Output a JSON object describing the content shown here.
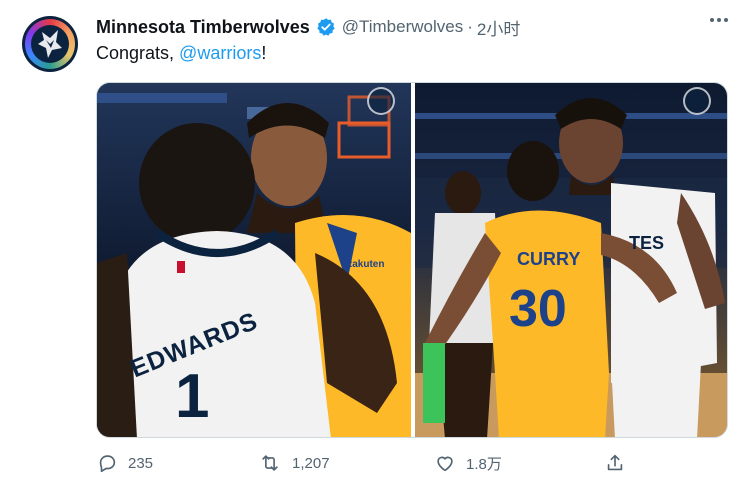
{
  "tweet": {
    "author_name": "Minnesota Timberwolves",
    "handle": "@Timberwolves",
    "separator": "·",
    "time": "2小时",
    "text_prefix": "Congrats, ",
    "mention": "@warriors",
    "text_suffix": "!"
  },
  "photos": {
    "left": {
      "jersey_name": "EDWARDS",
      "jersey_number": "1",
      "sponsor": "Rakuten"
    },
    "right": {
      "jersey_name": "CURRY",
      "jersey_number": "30",
      "jersey_name_2": "TES"
    }
  },
  "actions": {
    "reply_count": "235",
    "retweet_count": "1,207",
    "like_count": "1.8万"
  },
  "colors": {
    "link": "#1d9bf0",
    "verified": "#1d9bf0",
    "muted": "#536471",
    "warriors_gold": "#fdb927",
    "warriors_blue": "#1d428a",
    "wolves_navy": "#0c2340"
  },
  "icons": [
    "wolves-logo-icon",
    "verified-badge-icon",
    "more-options-icon",
    "reply-icon",
    "retweet-icon",
    "like-icon",
    "share-icon"
  ]
}
